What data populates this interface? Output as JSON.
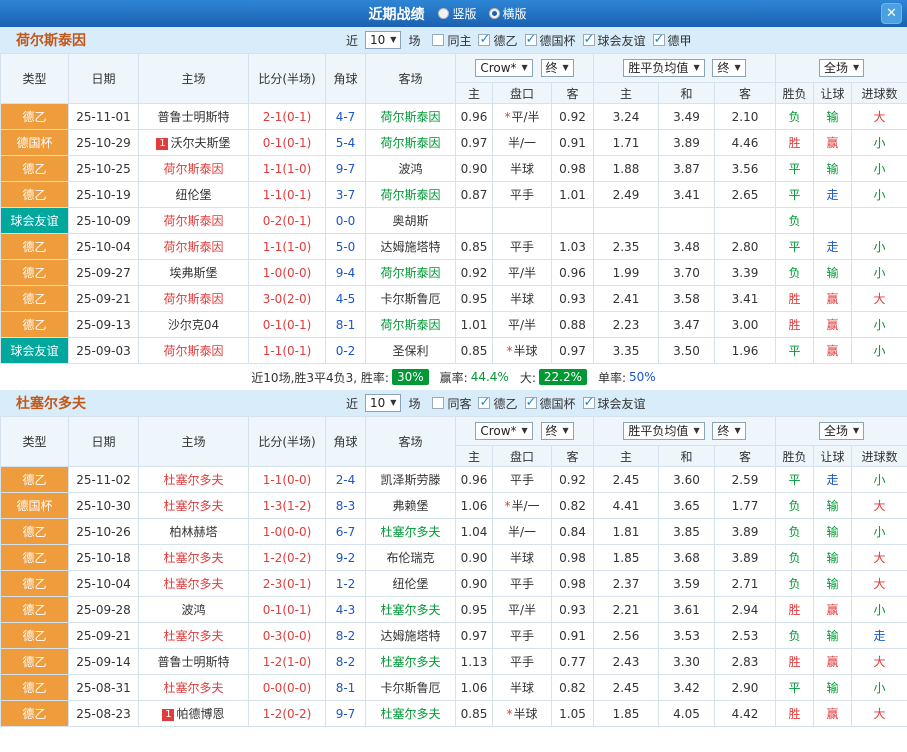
{
  "palette": {
    "orange": "#ef9c3d",
    "teal": "#00a79d",
    "red": "#e23b3b",
    "green": "#009933",
    "blue": "#1a56cc",
    "black": "#333333"
  },
  "icons": {
    "arrow_down": "▼",
    "close": "✕"
  },
  "titlebar": {
    "title": "近期战绩",
    "radio_vertical": "竖版",
    "radio_horizontal": "横版",
    "radio_selected": "横版"
  },
  "table_header": {
    "type": "类型",
    "date": "日期",
    "home": "主场",
    "score": "比分(半场)",
    "corners": "角球",
    "away": "客场",
    "bookmaker": "Crow*",
    "final1": "终",
    "avg": "胜平负均值",
    "final2": "终",
    "scope": "全场",
    "odds_home": "主",
    "handicap": "盘口",
    "odds_away": "客",
    "win": "主",
    "draw": "和",
    "lose": "客",
    "result": "胜负",
    "handicap_result": "让球",
    "goals": "进球数"
  },
  "sections": [
    {
      "team": "荷尔斯泰因",
      "filter": {
        "near_label": "近",
        "count": "10",
        "games_label": "场",
        "checkboxes": [
          {
            "label": "同主",
            "checked": false
          },
          {
            "label": "德乙",
            "checked": true
          },
          {
            "label": "德国杯",
            "checked": true
          },
          {
            "label": "球会友谊",
            "checked": true
          },
          {
            "label": "德甲",
            "checked": true
          }
        ]
      },
      "rows": [
        {
          "type": "德乙",
          "type_color": "orange",
          "date": "25-11-01",
          "home": "普鲁士明斯特",
          "home_color": "black",
          "home_badge": "",
          "score": "2-1(0-1)",
          "corners": "4-7",
          "away": "荷尔斯泰因",
          "away_color": "green",
          "away_badge": "",
          "o1": "0.96",
          "star": true,
          "hcap": "平/半",
          "o2": "0.92",
          "w": "3.24",
          "d": "3.49",
          "l": "2.10",
          "res": "负",
          "res_c": "green",
          "let": "输",
          "let_c": "green",
          "goal": "大",
          "goal_c": "red"
        },
        {
          "type": "德国杯",
          "type_color": "orange",
          "date": "25-10-29",
          "home": "沃尔夫斯堡",
          "home_color": "black",
          "home_badge": "1",
          "score": "0-1(0-1)",
          "corners": "5-4",
          "away": "荷尔斯泰因",
          "away_color": "green",
          "away_badge": "",
          "o1": "0.97",
          "star": false,
          "hcap": "半/一",
          "o2": "0.91",
          "w": "1.71",
          "d": "3.89",
          "l": "4.46",
          "res": "胜",
          "res_c": "red",
          "let": "赢",
          "let_c": "red",
          "goal": "小",
          "goal_c": "green"
        },
        {
          "type": "德乙",
          "type_color": "orange",
          "date": "25-10-25",
          "home": "荷尔斯泰因",
          "home_color": "red",
          "home_badge": "",
          "score": "1-1(1-0)",
          "corners": "9-7",
          "away": "波鸿",
          "away_color": "black",
          "away_badge": "",
          "o1": "0.90",
          "star": false,
          "hcap": "半球",
          "o2": "0.98",
          "w": "1.88",
          "d": "3.87",
          "l": "3.56",
          "res": "平",
          "res_c": "green",
          "let": "输",
          "let_c": "green",
          "goal": "小",
          "goal_c": "green"
        },
        {
          "type": "德乙",
          "type_color": "orange",
          "date": "25-10-19",
          "home": "纽伦堡",
          "home_color": "black",
          "home_badge": "",
          "score": "1-1(0-1)",
          "corners": "3-7",
          "away": "荷尔斯泰因",
          "away_color": "green",
          "away_badge": "",
          "o1": "0.87",
          "star": false,
          "hcap": "平手",
          "o2": "1.01",
          "w": "2.49",
          "d": "3.41",
          "l": "2.65",
          "res": "平",
          "res_c": "green",
          "let": "走",
          "let_c": "blue",
          "goal": "小",
          "goal_c": "green"
        },
        {
          "type": "球会友谊",
          "type_color": "teal",
          "date": "25-10-09",
          "home": "荷尔斯泰因",
          "home_color": "red",
          "home_badge": "",
          "score": "0-2(0-1)",
          "corners": "0-0",
          "away": "奥胡斯",
          "away_color": "black",
          "away_badge": "",
          "o1": "",
          "star": false,
          "hcap": "",
          "o2": "",
          "w": "",
          "d": "",
          "l": "",
          "res": "负",
          "res_c": "green",
          "let": "",
          "let_c": "black",
          "goal": "",
          "goal_c": "black"
        },
        {
          "type": "德乙",
          "type_color": "orange",
          "date": "25-10-04",
          "home": "荷尔斯泰因",
          "home_color": "red",
          "home_badge": "",
          "score": "1-1(1-0)",
          "corners": "5-0",
          "away": "达姆施塔特",
          "away_color": "black",
          "away_badge": "",
          "o1": "0.85",
          "star": false,
          "hcap": "平手",
          "o2": "1.03",
          "w": "2.35",
          "d": "3.48",
          "l": "2.80",
          "res": "平",
          "res_c": "green",
          "let": "走",
          "let_c": "blue",
          "goal": "小",
          "goal_c": "green"
        },
        {
          "type": "德乙",
          "type_color": "orange",
          "date": "25-09-27",
          "home": "埃弗斯堡",
          "home_color": "black",
          "home_badge": "",
          "score": "1-0(0-0)",
          "corners": "9-4",
          "away": "荷尔斯泰因",
          "away_color": "green",
          "away_badge": "",
          "o1": "0.92",
          "star": false,
          "hcap": "平/半",
          "o2": "0.96",
          "w": "1.99",
          "d": "3.70",
          "l": "3.39",
          "res": "负",
          "res_c": "green",
          "let": "输",
          "let_c": "green",
          "goal": "小",
          "goal_c": "green"
        },
        {
          "type": "德乙",
          "type_color": "orange",
          "date": "25-09-21",
          "home": "荷尔斯泰因",
          "home_color": "red",
          "home_badge": "",
          "score": "3-0(2-0)",
          "corners": "4-5",
          "away": "卡尔斯鲁厄",
          "away_color": "black",
          "away_badge": "",
          "o1": "0.95",
          "star": false,
          "hcap": "半球",
          "o2": "0.93",
          "w": "2.41",
          "d": "3.58",
          "l": "3.41",
          "res": "胜",
          "res_c": "red",
          "let": "赢",
          "let_c": "red",
          "goal": "大",
          "goal_c": "red"
        },
        {
          "type": "德乙",
          "type_color": "orange",
          "date": "25-09-13",
          "home": "沙尔克04",
          "home_color": "black",
          "home_badge": "",
          "score": "0-1(0-1)",
          "corners": "8-1",
          "away": "荷尔斯泰因",
          "away_color": "green",
          "away_badge": "",
          "o1": "1.01",
          "star": false,
          "hcap": "平/半",
          "o2": "0.88",
          "w": "2.23",
          "d": "3.47",
          "l": "3.00",
          "res": "胜",
          "res_c": "red",
          "let": "赢",
          "let_c": "red",
          "goal": "小",
          "goal_c": "green"
        },
        {
          "type": "球会友谊",
          "type_color": "teal",
          "date": "25-09-03",
          "home": "荷尔斯泰因",
          "home_color": "red",
          "home_badge": "",
          "score": "1-1(0-1)",
          "corners": "0-2",
          "away": "圣保利",
          "away_color": "black",
          "away_badge": "",
          "o1": "0.85",
          "star": true,
          "hcap": "半球",
          "o2": "0.97",
          "w": "3.35",
          "d": "3.50",
          "l": "1.96",
          "res": "平",
          "res_c": "green",
          "let": "赢",
          "let_c": "red",
          "goal": "小",
          "goal_c": "green"
        }
      ],
      "summary": {
        "prefix": "近10场,胜3平4负3, 胜率:",
        "win_rate": "30%",
        "label_win_odds": "赢率:",
        "win_odds_rate": "44.4%",
        "label_big": "大:",
        "big_rate": "22.2%",
        "label_single": "单率:",
        "single_rate": "50%"
      }
    },
    {
      "team": "杜塞尔多夫",
      "filter": {
        "near_label": "近",
        "count": "10",
        "games_label": "场",
        "checkboxes": [
          {
            "label": "同客",
            "checked": false
          },
          {
            "label": "德乙",
            "checked": true
          },
          {
            "label": "德国杯",
            "checked": true
          },
          {
            "label": "球会友谊",
            "checked": true
          }
        ]
      },
      "rows": [
        {
          "type": "德乙",
          "type_color": "orange",
          "date": "25-11-02",
          "home": "杜塞尔多夫",
          "home_color": "red",
          "home_badge": "",
          "score": "1-1(0-0)",
          "corners": "2-4",
          "away": "凯泽斯劳滕",
          "away_color": "black",
          "away_badge": "",
          "o1": "0.96",
          "star": false,
          "hcap": "平手",
          "o2": "0.92",
          "w": "2.45",
          "d": "3.60",
          "l": "2.59",
          "res": "平",
          "res_c": "green",
          "let": "走",
          "let_c": "blue",
          "goal": "小",
          "goal_c": "green"
        },
        {
          "type": "德国杯",
          "type_color": "orange",
          "date": "25-10-30",
          "home": "杜塞尔多夫",
          "home_color": "red",
          "home_badge": "",
          "score": "1-3(1-2)",
          "corners": "8-3",
          "away": "弗赖堡",
          "away_color": "black",
          "away_badge": "",
          "o1": "1.06",
          "star": true,
          "hcap": "半/一",
          "o2": "0.82",
          "w": "4.41",
          "d": "3.65",
          "l": "1.77",
          "res": "负",
          "res_c": "green",
          "let": "输",
          "let_c": "green",
          "goal": "大",
          "goal_c": "red"
        },
        {
          "type": "德乙",
          "type_color": "orange",
          "date": "25-10-26",
          "home": "柏林赫塔",
          "home_color": "black",
          "home_badge": "",
          "score": "1-0(0-0)",
          "corners": "6-7",
          "away": "杜塞尔多夫",
          "away_color": "green",
          "away_badge": "",
          "o1": "1.04",
          "star": false,
          "hcap": "半/一",
          "o2": "0.84",
          "w": "1.81",
          "d": "3.85",
          "l": "3.89",
          "res": "负",
          "res_c": "green",
          "let": "输",
          "let_c": "green",
          "goal": "小",
          "goal_c": "green"
        },
        {
          "type": "德乙",
          "type_color": "orange",
          "date": "25-10-18",
          "home": "杜塞尔多夫",
          "home_color": "red",
          "home_badge": "",
          "score": "1-2(0-2)",
          "corners": "9-2",
          "away": "布伦瑞克",
          "away_color": "black",
          "away_badge": "",
          "o1": "0.90",
          "star": false,
          "hcap": "半球",
          "o2": "0.98",
          "w": "1.85",
          "d": "3.68",
          "l": "3.89",
          "res": "负",
          "res_c": "green",
          "let": "输",
          "let_c": "green",
          "goal": "大",
          "goal_c": "red"
        },
        {
          "type": "德乙",
          "type_color": "orange",
          "date": "25-10-04",
          "home": "杜塞尔多夫",
          "home_color": "red",
          "home_badge": "",
          "score": "2-3(0-1)",
          "corners": "1-2",
          "away": "纽伦堡",
          "away_color": "black",
          "away_badge": "",
          "o1": "0.90",
          "star": false,
          "hcap": "平手",
          "o2": "0.98",
          "w": "2.37",
          "d": "3.59",
          "l": "2.71",
          "res": "负",
          "res_c": "green",
          "let": "输",
          "let_c": "green",
          "goal": "大",
          "goal_c": "red"
        },
        {
          "type": "德乙",
          "type_color": "orange",
          "date": "25-09-28",
          "home": "波鸿",
          "home_color": "black",
          "home_badge": "",
          "score": "0-1(0-1)",
          "corners": "4-3",
          "away": "杜塞尔多夫",
          "away_color": "green",
          "away_badge": "",
          "o1": "0.95",
          "star": false,
          "hcap": "平/半",
          "o2": "0.93",
          "w": "2.21",
          "d": "3.61",
          "l": "2.94",
          "res": "胜",
          "res_c": "red",
          "let": "赢",
          "let_c": "red",
          "goal": "小",
          "goal_c": "green"
        },
        {
          "type": "德乙",
          "type_color": "orange",
          "date": "25-09-21",
          "home": "杜塞尔多夫",
          "home_color": "red",
          "home_badge": "",
          "score": "0-3(0-0)",
          "corners": "8-2",
          "away": "达姆施塔特",
          "away_color": "black",
          "away_badge": "",
          "o1": "0.97",
          "star": false,
          "hcap": "平手",
          "o2": "0.91",
          "w": "2.56",
          "d": "3.53",
          "l": "2.53",
          "res": "负",
          "res_c": "green",
          "let": "输",
          "let_c": "green",
          "goal": "走",
          "goal_c": "blue"
        },
        {
          "type": "德乙",
          "type_color": "orange",
          "date": "25-09-14",
          "home": "普鲁士明斯特",
          "home_color": "black",
          "home_badge": "",
          "score": "1-2(1-0)",
          "corners": "8-2",
          "away": "杜塞尔多夫",
          "away_color": "green",
          "away_badge": "",
          "o1": "1.13",
          "star": false,
          "hcap": "平手",
          "o2": "0.77",
          "w": "2.43",
          "d": "3.30",
          "l": "2.83",
          "res": "胜",
          "res_c": "red",
          "let": "赢",
          "let_c": "red",
          "goal": "大",
          "goal_c": "red"
        },
        {
          "type": "德乙",
          "type_color": "orange",
          "date": "25-08-31",
          "home": "杜塞尔多夫",
          "home_color": "red",
          "home_badge": "",
          "score": "0-0(0-0)",
          "corners": "8-1",
          "away": "卡尔斯鲁厄",
          "away_color": "black",
          "away_badge": "",
          "o1": "1.06",
          "star": false,
          "hcap": "半球",
          "o2": "0.82",
          "w": "2.45",
          "d": "3.42",
          "l": "2.90",
          "res": "平",
          "res_c": "green",
          "let": "输",
          "let_c": "green",
          "goal": "小",
          "goal_c": "green"
        },
        {
          "type": "德乙",
          "type_color": "orange",
          "date": "25-08-23",
          "home": "帕德博恩",
          "home_color": "black",
          "home_badge": "1",
          "score": "1-2(0-2)",
          "corners": "9-7",
          "away": "杜塞尔多夫",
          "away_color": "green",
          "away_badge": "",
          "o1": "0.85",
          "star": true,
          "hcap": "半球",
          "o2": "1.05",
          "w": "1.85",
          "d": "4.05",
          "l": "4.42",
          "res": "胜",
          "res_c": "red",
          "let": "赢",
          "let_c": "red",
          "goal": "大",
          "goal_c": "red"
        }
      ]
    }
  ]
}
